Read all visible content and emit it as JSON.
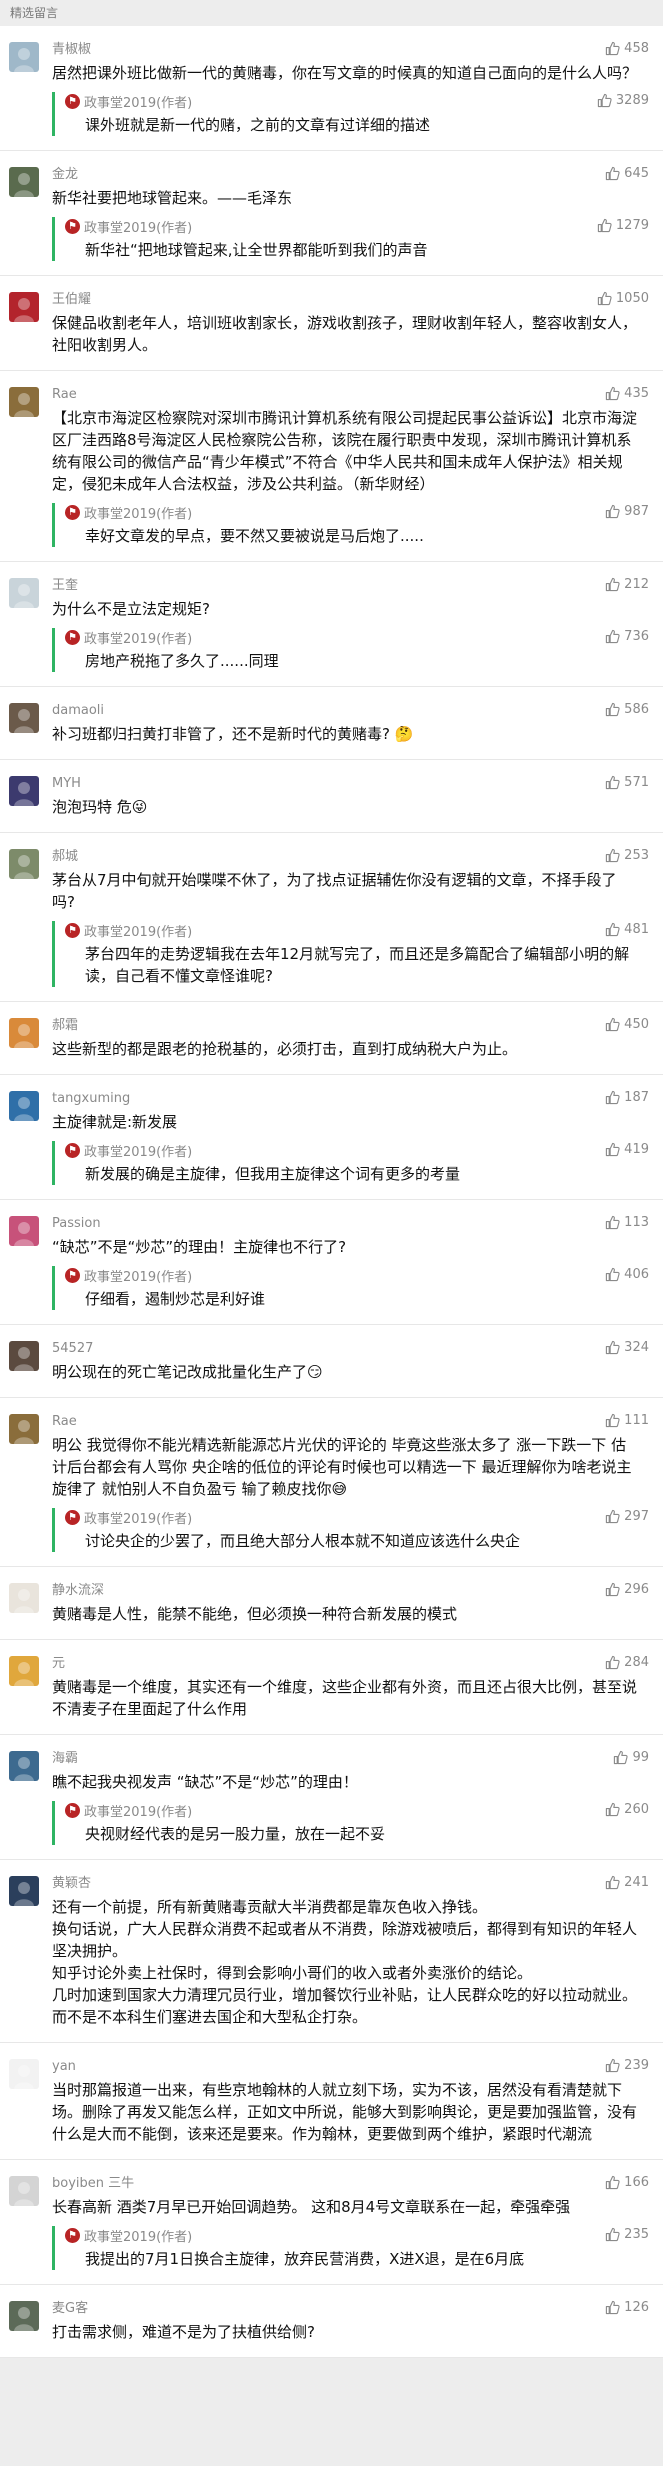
{
  "header": {
    "title": "精选留言"
  },
  "colors": {
    "accent": "#2fb463",
    "muted": "#8a8a8a",
    "official_badge": "#b82425"
  },
  "comments": [
    {
      "nick": "青椒椒",
      "likes": "458",
      "text": "居然把课外班比做新一代的黄赌毒，你在写文章的时候真的知道自己面向的是什么人吗？",
      "avatar_color": "#9fb8c9",
      "reply": {
        "author": "政事堂2019(作者)",
        "likes": "3289",
        "text": "课外班就是新一代的赌，之前的文章有过详细的描述"
      }
    },
    {
      "nick": "金龙",
      "likes": "645",
      "text": "新华社要把地球管起来。——毛泽东",
      "avatar_color": "#5a6b4e",
      "reply": {
        "author": "政事堂2019(作者)",
        "likes": "1279",
        "text": "新华社“把地球管起来,让全世界都能听到我们的声音"
      }
    },
    {
      "nick": "王伯耀",
      "likes": "1050",
      "text": "保健品收割老年人，培训班收割家长，游戏收割孩子，理财收割年轻人，整容收割女人，社阳收割男人。",
      "avatar_color": "#b3242c"
    },
    {
      "nick": "Rae",
      "likes": "435",
      "text": "【北京市海淀区检察院对深圳市腾讯计算机系统有限公司提起民事公益诉讼】北京市海淀区厂洼西路8号海淀区人民检察院公告称，该院在履行职责中发现，深圳市腾讯计算机系统有限公司的微信产品“青少年模式”不符合《中华人民共和国未成年人保护法》相关规定，侵犯未成年人合法权益，涉及公共利益。（新华财经）",
      "avatar_color": "#8a6d3b",
      "reply": {
        "author": "政事堂2019(作者)",
        "likes": "987",
        "text": "幸好文章发的早点，要不然又要被说是马后炮了....."
      }
    },
    {
      "nick": "王奎",
      "likes": "212",
      "text": "为什么不是立法定规矩?",
      "avatar_color": "#c9d4da",
      "reply": {
        "author": "政事堂2019(作者)",
        "likes": "736",
        "text": "房地产税拖了多久了......同理"
      }
    },
    {
      "nick": "damaoli",
      "likes": "586",
      "text": "补习班都归扫黄打非管了，还不是新时代的黄赌毒? 🤔",
      "avatar_color": "#6b5a4a"
    },
    {
      "nick": "MYH",
      "likes": "571",
      "text": "泡泡玛特  危😜",
      "avatar_color": "#3c3a6e"
    },
    {
      "nick": "郝城",
      "likes": "253",
      "text": "茅台从7月中旬就开始喋喋不休了，为了找点证据辅佐你没有逻辑的文章，不择手段了吗?",
      "avatar_color": "#7d8b6a",
      "reply": {
        "author": "政事堂2019(作者)",
        "likes": "481",
        "text": "茅台四年的走势逻辑我在去年12月就写完了，而且还是多篇配合了编辑部小明的解读，自己看不懂文章怪谁呢?"
      }
    },
    {
      "nick": "郝霜",
      "likes": "450",
      "text": "这些新型的都是跟老的抢税基的，必须打击，直到打成纳税大户为止。",
      "avatar_color": "#d98a3a"
    },
    {
      "nick": "tangxuming",
      "likes": "187",
      "text": "主旋律就是:新发展",
      "avatar_color": "#2f6fa8",
      "reply": {
        "author": "政事堂2019(作者)",
        "likes": "419",
        "text": "新发展的确是主旋律，但我用主旋律这个词有更多的考量"
      }
    },
    {
      "nick": "Passion",
      "likes": "113",
      "text": "“缺芯”不是“炒芯”的理由！主旋律也不行了?",
      "avatar_color": "#c7527a",
      "reply": {
        "author": "政事堂2019(作者)",
        "likes": "406",
        "text": "仔细看，遏制炒芯是利好谁"
      }
    },
    {
      "nick": "54527",
      "likes": "324",
      "text": "明公现在的死亡笔记改成批量化生产了😏",
      "avatar_color": "#5b4a3f"
    },
    {
      "nick": "Rae",
      "likes": "111",
      "text": "明公 我觉得你不能光精选新能源芯片光伏的评论的 毕竟这些涨太多了 涨一下跌一下 估计后台都会有人骂你 央企啥的低位的评论有时候也可以精选一下 最近理解你为啥老说主旋律了 就怕别人不自负盈亏 输了赖皮找你😅",
      "avatar_color": "#8a6d3b",
      "reply": {
        "author": "政事堂2019(作者)",
        "likes": "297",
        "text": "讨论央企的少罢了，而且绝大部分人根本就不知道应该选什么央企"
      }
    },
    {
      "nick": "静水流深",
      "likes": "296",
      "text": "黄赌毒是人性，能禁不能绝，但必须换一种符合新发展的模式",
      "avatar_color": "#e9e4dc"
    },
    {
      "nick": "元",
      "likes": "284",
      "text": "黄赌毒是一个维度，其实还有一个维度，这些企业都有外资，而且还占很大比例，甚至说不清麦子在里面起了什么作用",
      "avatar_color": "#e0a73c"
    },
    {
      "nick": "海霸",
      "likes": "99",
      "text": "瞧不起我央视发声 “缺芯”不是“炒芯”的理由！",
      "avatar_color": "#3d6a8f",
      "reply": {
        "author": "政事堂2019(作者)",
        "likes": "260",
        "text": "央视财经代表的是另一股力量，放在一起不妥"
      }
    },
    {
      "nick": "黄颖杏",
      "likes": "241",
      "text": "还有一个前提，所有新黄赌毒贡献大半消费都是靠灰色收入挣钱。\n换句话说，广大人民群众消费不起或者从不消费，除游戏被喷后，都得到有知识的年轻人坚决拥护。\n知乎讨论外卖上社保时，得到会影响小哥们的收入或者外卖涨价的结论。\n几时加速到国家大力清理冗员行业，增加餐饮行业补贴，让人民群众吃的好以拉动就业。\n而不是不本科生们塞进去国企和大型私企打杂。",
      "avatar_color": "#2b3f5c"
    },
    {
      "nick": "yan",
      "likes": "239",
      "text": "当时那篇报道一出来，有些京地翰林的人就立刻下场，实为不该，居然没有看清楚就下场。删除了再发又能怎么样，正如文中所说，能够大到影响舆论，更是要加强监管，没有什么是大而不能倒，该来还是要来。作为翰林，更要做到两个维护，紧跟时代潮流",
      "avatar_color": "#f2f2f2"
    },
    {
      "nick": "boyiben 三牛",
      "likes": "166",
      "text": "长春高新 酒类7月早已开始回调趋势。 这和8月4号文章联系在一起，牵强牵强",
      "avatar_color": "#d4d4d4",
      "reply": {
        "author": "政事堂2019(作者)",
        "likes": "235",
        "text": "我提出的7月1日换合主旋律，放弃民营消费，X进X退，是在6月底"
      }
    },
    {
      "nick": "麦G客",
      "likes": "126",
      "text": "打击需求侧，难道不是为了扶植供给侧?",
      "avatar_color": "#5c6a58"
    }
  ]
}
